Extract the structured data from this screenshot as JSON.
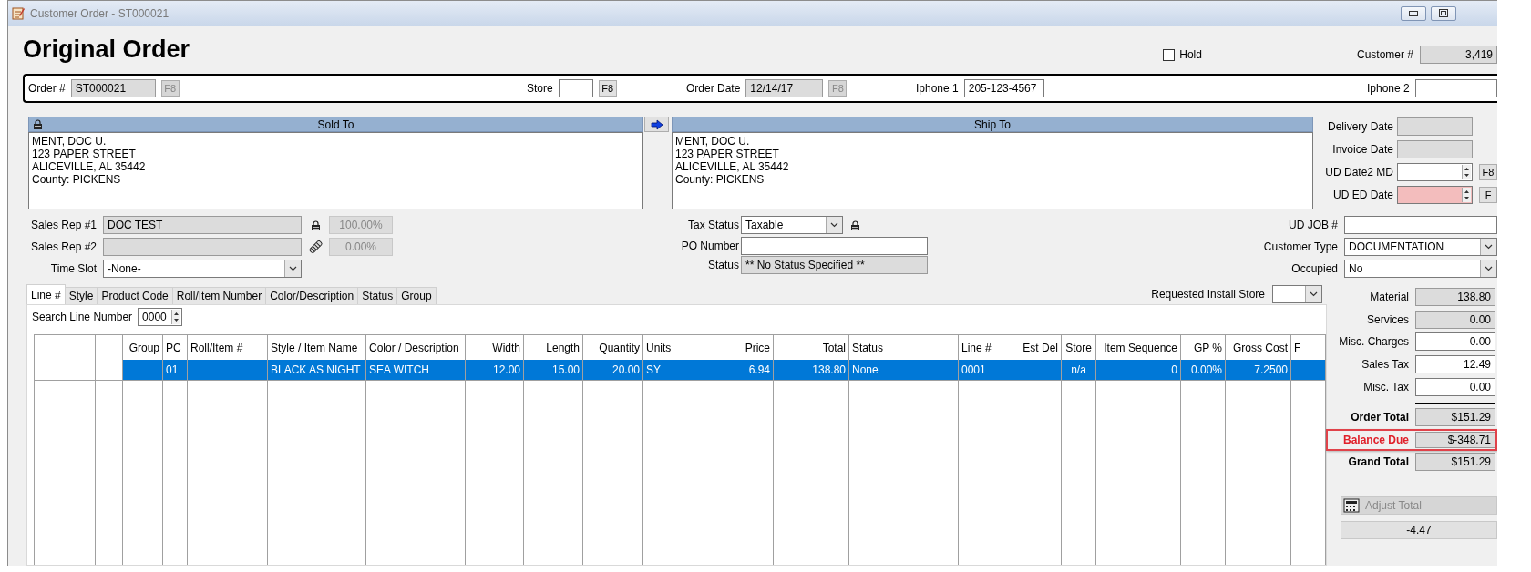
{
  "window": {
    "title": "Customer Order - ST000021"
  },
  "heading": "Original Order",
  "hold": {
    "label": "Hold",
    "checked": false
  },
  "customer_number": {
    "label": "Customer #",
    "value": "3,419"
  },
  "order_fields": [
    {
      "label": "Order #",
      "value": "ST000021",
      "readonly": true,
      "button": {
        "label": "F8",
        "disabled": true
      }
    },
    {
      "label": "Store",
      "readonly": false,
      "button": {
        "label": "F8",
        "disabled": false
      }
    },
    {
      "label": "Order Date",
      "value": "12/14/17",
      "readonly": true,
      "button": {
        "label": "F8",
        "disabled": true
      }
    },
    {
      "label": "Iphone 1",
      "value": "205-123-4567",
      "readonly": false
    },
    {
      "label": "Iphone 2",
      "readonly": false
    }
  ],
  "sold_to": {
    "title": "Sold To",
    "lines": [
      "MENT, DOC U.",
      "123 PAPER STREET",
      "ALICEVILLE, AL  35442",
      "County: PICKENS"
    ]
  },
  "ship_to": {
    "title": "Ship To",
    "lines": [
      "MENT, DOC U.",
      "123 PAPER STREET",
      "ALICEVILLE, AL  35442",
      "County: PICKENS"
    ]
  },
  "date_fields": [
    {
      "label": "Delivery Date",
      "kind": "readonly"
    },
    {
      "label": "Invoice Date",
      "kind": "readonly"
    },
    {
      "label": "UD Date2 MD",
      "kind": "spin",
      "required": false,
      "button": "F8"
    },
    {
      "label": "UD ED Date",
      "kind": "spin",
      "required": true,
      "button": "F"
    }
  ],
  "sales_reps": [
    {
      "label": "Sales Rep #1",
      "value": "DOC TEST",
      "percent": "100.00%"
    },
    {
      "label": "Sales Rep #2",
      "percent": "0.00%"
    }
  ],
  "time_slot": {
    "label": "Time Slot",
    "value": "-None-"
  },
  "tax_status": {
    "label": "Tax Status",
    "value": "Taxable"
  },
  "po_number": {
    "label": "PO Number"
  },
  "status": {
    "label": "Status",
    "value": "** No Status Specified **"
  },
  "job_fields": [
    {
      "label": "UD JOB #",
      "kind": "text"
    },
    {
      "label": "Customer Type",
      "kind": "combo",
      "value": "DOCUMENTATION"
    },
    {
      "label": "Occupied",
      "kind": "combo",
      "value": "No"
    }
  ],
  "tabs": [
    {
      "label": "Line #",
      "selected": true
    },
    {
      "label": "Style",
      "selected": false
    },
    {
      "label": "Product Code",
      "selected": false
    },
    {
      "label": "Roll/Item Number",
      "selected": false
    },
    {
      "label": "Color/Description",
      "selected": false
    },
    {
      "label": "Status",
      "selected": false
    },
    {
      "label": "Group",
      "selected": false
    }
  ],
  "requested_install_store": {
    "label": "Requested Install Store"
  },
  "search_line": {
    "label": "Search Line Number",
    "value": "0000"
  },
  "table": {
    "columns": [
      null,
      null,
      "Group",
      "PC",
      "Roll/Item #",
      "Style / Item Name",
      "Color / Description",
      "Width",
      "Length",
      "Quantity",
      "Units",
      null,
      "Price",
      "Total",
      "Status",
      "Line #",
      "Est Del",
      "Store",
      "Item Sequence",
      "GP %",
      "Gross Cost",
      "F"
    ],
    "rows": [
      {
        "selected": true,
        "cells": [
          null,
          null,
          null,
          "01",
          null,
          "BLACK AS NIGHT",
          "SEA WITCH",
          "12.00",
          "15.00",
          "20.00",
          "SY",
          null,
          "6.94",
          "138.80",
          "None",
          "0001",
          null,
          "n/a",
          "0",
          "0.00%",
          "7.2500",
          null
        ]
      }
    ]
  },
  "totals": [
    {
      "label": "Material",
      "value": "138.80",
      "kind": "readonly"
    },
    {
      "label": "Services",
      "value": "0.00",
      "kind": "readonly"
    },
    {
      "label": "Misc. Charges",
      "value": "0.00",
      "kind": "input"
    },
    {
      "label": "Sales Tax",
      "value": "12.49",
      "kind": "input"
    },
    {
      "label": "Misc. Tax",
      "value": "0.00",
      "kind": "input"
    },
    {
      "label": "Order Total",
      "value": "$151.29",
      "kind": "total"
    },
    {
      "label": "Balance Due",
      "value": "$-348.71",
      "kind": "alert"
    },
    {
      "label": "Grand Total",
      "value": "$151.29",
      "kind": "total"
    }
  ],
  "adjust_total": {
    "label": "Adjust Total",
    "disabled": true,
    "value": "-4.47"
  }
}
